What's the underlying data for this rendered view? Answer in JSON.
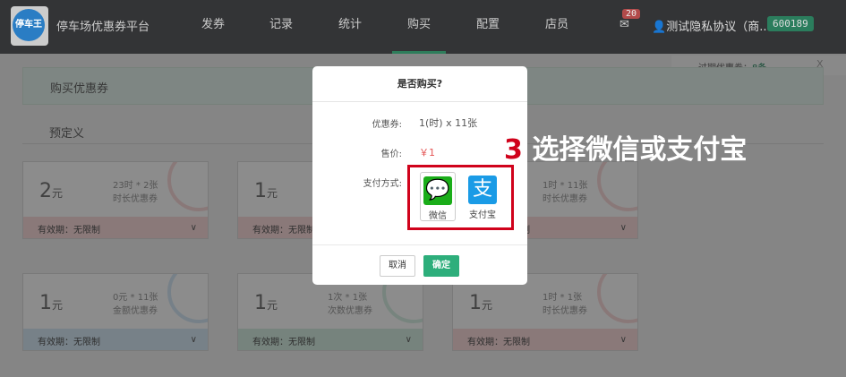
{
  "header": {
    "logo_text": "停车王",
    "brand": "停车场优惠券平台",
    "nav": [
      "发券",
      "记录",
      "统计",
      "购买",
      "配置",
      "店员"
    ],
    "active": "购买",
    "mail_count": "20",
    "user": "测试隐私协议（商...",
    "code": "600189"
  },
  "notice": {
    "label": "过期优惠券：",
    "count": "8条",
    "close": "X"
  },
  "panel_title": "购买优惠券",
  "section": "预定义",
  "cards": [
    {
      "amount": "2",
      "unit": "元",
      "d1": "23时 * 2张",
      "d2": "时长优惠券",
      "validity": "有效期：无限制",
      "color": "red"
    },
    {
      "amount": "1",
      "unit": "元",
      "d1": "",
      "d2": "",
      "validity": "有效期：无限制",
      "color": "red"
    },
    {
      "amount": "1",
      "unit": "元",
      "d1": "1时 * 11张",
      "d2": "时长优惠券",
      "validity": "有效期：无限制",
      "color": "red"
    },
    {
      "amount": "1",
      "unit": "元",
      "d1": "0元 * 11张",
      "d2": "金额优惠券",
      "validity": "有效期：无限制",
      "color": "blue"
    },
    {
      "amount": "1",
      "unit": "元",
      "d1": "1次 * 1张",
      "d2": "次数优惠券",
      "validity": "有效期：无限制",
      "color": "green"
    },
    {
      "amount": "1",
      "unit": "元",
      "d1": "1时 * 1张",
      "d2": "时长优惠券",
      "validity": "有效期：无限制",
      "color": "red"
    }
  ],
  "modal": {
    "title": "是否购买?",
    "coupon_label": "优惠券:",
    "coupon_value": "1(时) x 11张",
    "price_label": "售价:",
    "price_value": "￥1",
    "pay_label": "支付方式:",
    "wechat": "微信",
    "alipay": "支付宝",
    "cancel": "取消",
    "confirm": "确定"
  },
  "annotation": {
    "step": "3",
    "text": " 选择微信或支付宝"
  }
}
